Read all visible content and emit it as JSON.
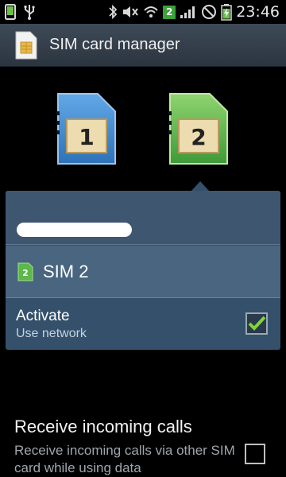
{
  "status_bar": {
    "time": "23:46",
    "sim_badge": "2",
    "icons": [
      "phone-icon",
      "usb-icon",
      "bluetooth-icon",
      "mute-icon",
      "wifi-icon",
      "sim-2-badge-icon",
      "signal-icon",
      "no-signal-icon",
      "battery-charging-icon"
    ]
  },
  "header": {
    "title": "SIM card manager",
    "icon": "sim-card-icon"
  },
  "sims": [
    {
      "number": "1",
      "color": "#3f8ad3"
    },
    {
      "number": "2",
      "color": "#56b34a"
    }
  ],
  "panel": {
    "sim_badge": "2",
    "sim_name": "SIM 2",
    "activate_title": "Activate",
    "activate_subtitle": "Use network",
    "activate_checked": true
  },
  "settings": {
    "incoming_title": "Receive incoming calls",
    "incoming_desc": "Receive incoming calls via other SIM card while using data",
    "incoming_checked": false
  }
}
